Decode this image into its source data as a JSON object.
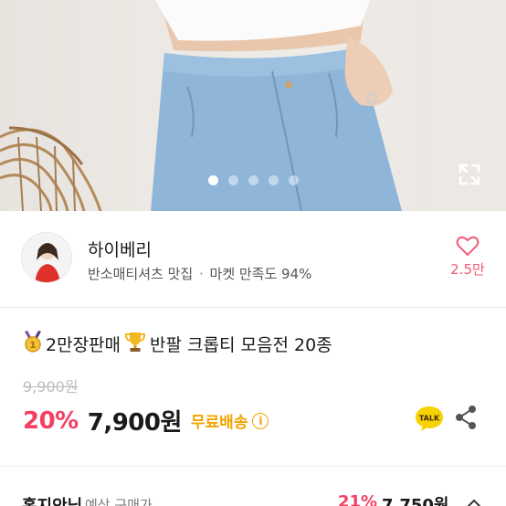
{
  "carousel": {
    "total_images": 5,
    "active_index": 0
  },
  "seller": {
    "name": "하이베리",
    "tagline": "반소매티셔츠 맛집",
    "separator": "·",
    "satisfaction": "마켓 만족도 94%",
    "likes": "2.5만"
  },
  "product": {
    "title": "2만장판매",
    "title_rest": "반팔 크롭티 모음전 20종",
    "original_price": "9,900원",
    "discount": "20%",
    "price": "7,900원",
    "shipping": "무료배송",
    "info_glyph": "i"
  },
  "icons": {
    "medal": "medal-icon",
    "trophy": "trophy-icon",
    "heart": "heart-icon",
    "expand": "expand-icon",
    "talk": "kakaotalk-icon",
    "share": "share-icon",
    "chevron": "chevron-up-icon"
  },
  "bottom_bar": {
    "name": "홍지안님",
    "label": "예상 구매가",
    "discount": "21%",
    "price": "7,750원"
  },
  "colors": {
    "accent_pink": "#f33f62",
    "like_pink": "#f25b79",
    "shipping_yellow": "#f2a400",
    "talk_yellow": "#f7d100"
  }
}
